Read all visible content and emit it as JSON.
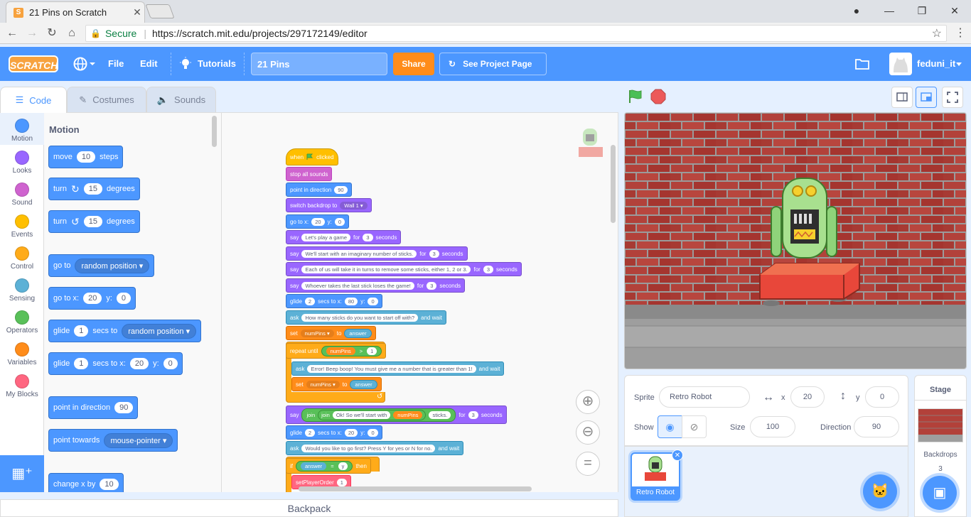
{
  "browser": {
    "tab_title": "21 Pins on Scratch",
    "tab_close": "✕",
    "secure_label": "Secure",
    "url": "https://scratch.mit.edu/projects/297172149/editor"
  },
  "menu": {
    "file": "File",
    "edit": "Edit",
    "tutorials": "Tutorials",
    "project_title": "21 Pins",
    "share": "Share",
    "see_project_page": "See Project Page",
    "username": "feduni_it"
  },
  "editor_tabs": {
    "code": "Code",
    "costumes": "Costumes",
    "sounds": "Sounds"
  },
  "categories": [
    {
      "label": "Motion",
      "color": "#4c97ff"
    },
    {
      "label": "Looks",
      "color": "#9966ff"
    },
    {
      "label": "Sound",
      "color": "#cf63cf"
    },
    {
      "label": "Events",
      "color": "#ffbf00"
    },
    {
      "label": "Control",
      "color": "#ffab19"
    },
    {
      "label": "Sensing",
      "color": "#5cb1d6"
    },
    {
      "label": "Operators",
      "color": "#59c059"
    },
    {
      "label": "Variables",
      "color": "#ff8c1a"
    },
    {
      "label": "My Blocks",
      "color": "#ff6680"
    }
  ],
  "palette": {
    "title": "Motion",
    "move": {
      "a": "move",
      "v": "10",
      "b": "steps"
    },
    "turn_cw": {
      "a": "turn",
      "v": "15",
      "b": "degrees"
    },
    "turn_ccw": {
      "a": "turn",
      "v": "15",
      "b": "degrees"
    },
    "goto": {
      "a": "go to",
      "d": "random position"
    },
    "gotoxy": {
      "a": "go to x:",
      "x": "20",
      "b": "y:",
      "y": "0"
    },
    "glide": {
      "a": "glide",
      "v": "1",
      "b": "secs to",
      "d": "random position"
    },
    "glidexy": {
      "a": "glide",
      "v": "1",
      "b": "secs to x:",
      "x": "20",
      "c": "y:",
      "y": "0"
    },
    "pointdir": {
      "a": "point in direction",
      "v": "90"
    },
    "pointtowards": {
      "a": "point towards",
      "d": "mouse-pointer"
    },
    "changex": {
      "a": "change x by",
      "v": "10"
    }
  },
  "script": {
    "hat": {
      "a": "when",
      "b": "clicked"
    },
    "stop": "stop all sounds",
    "pointdir": {
      "a": "point in direction",
      "v": "90"
    },
    "backdrop": {
      "a": "switch backdrop to",
      "d": "Wall 1"
    },
    "gotoxy": {
      "a": "go to x:",
      "x": "20",
      "b": "y:",
      "y": "0"
    },
    "say1": {
      "a": "say",
      "t": "Let's play a game",
      "b": "for",
      "n": "3",
      "c": "seconds"
    },
    "say2": {
      "a": "say",
      "t": "We'll start with an imaginary number of sticks.",
      "b": "for",
      "n": "3",
      "c": "seconds"
    },
    "say3": {
      "a": "say",
      "t": "Each of us will take it in turns to remove some sticks, either 1, 2 or 3.",
      "b": "for",
      "n": "3",
      "c": "seconds"
    },
    "say4": {
      "a": "say",
      "t": "Whoever takes the last stick loses the game!",
      "b": "for",
      "n": "3",
      "c": "seconds"
    },
    "glide1": {
      "a": "glide",
      "v": "2",
      "b": "secs to x:",
      "x": "80",
      "c": "y:",
      "y": "0"
    },
    "ask1": {
      "a": "ask",
      "t": "How many sticks do you want to start off with?",
      "b": "and wait"
    },
    "set1": {
      "a": "set",
      "d": "numPins",
      "b": "to",
      "r": "answer"
    },
    "repeat": {
      "a": "repeat until",
      "r": "numPins",
      "op": ">",
      "v": "1"
    },
    "ask2": {
      "a": "ask",
      "t": "Error! Beep boop! You must give me a number that is greater than 1!",
      "b": "and wait"
    },
    "set2": {
      "a": "set",
      "d": "numPins",
      "b": "to",
      "r": "answer"
    },
    "loop_arrow": "↺",
    "say5": {
      "a": "say",
      "j1": "join",
      "j2": "join",
      "t": "Ok! So we'll start with",
      "r": "numPins",
      "t2": "sticks.",
      "b": "for",
      "n": "3",
      "c": "seconds"
    },
    "glide2": {
      "a": "glide",
      "v": "2",
      "b": "secs to x:",
      "x": "20",
      "c": "y:",
      "y": "0"
    },
    "ask3": {
      "a": "ask",
      "t": "Would you like to go first? Press Y for yes or N for no.",
      "b": "and wait"
    },
    "if": {
      "a": "if",
      "r": "answer",
      "op": "=",
      "v": "y",
      "b": "then"
    },
    "call": {
      "a": "setPlayerOrder",
      "v": "1"
    }
  },
  "backpack": "Backpack",
  "sprite_info": {
    "sprite_label": "Sprite",
    "sprite_name": "Retro Robot",
    "x_label": "x",
    "x": "20",
    "y_label": "y",
    "y": "0",
    "show_label": "Show",
    "size_label": "Size",
    "size": "100",
    "direction_label": "Direction",
    "direction": "90"
  },
  "sprite_list": [
    {
      "name": "Retro Robot"
    }
  ],
  "stage_pane": {
    "title": "Stage",
    "backdrops_label": "Backdrops",
    "backdrops_count": "3"
  },
  "colors": {
    "accent": "#4c97ff",
    "share": "#ff8c1a",
    "brick": "#a83a32"
  }
}
